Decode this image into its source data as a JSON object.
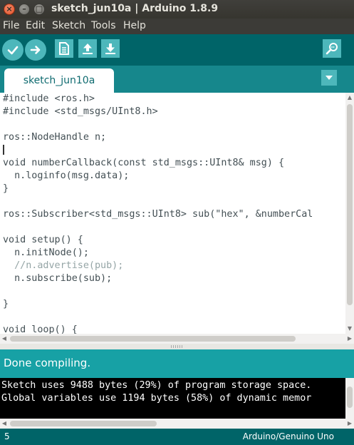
{
  "window": {
    "title": "sketch_jun10a | Arduino 1.8.9",
    "close_glyph": "×",
    "minimize_glyph": "–",
    "maximize_glyph": "□"
  },
  "menu": {
    "items": [
      "File",
      "Edit",
      "Sketch",
      "Tools",
      "Help"
    ]
  },
  "toolbar": {
    "buttons": [
      "verify-icon",
      "upload-icon",
      "new-icon",
      "open-icon",
      "save-icon",
      "serial-monitor-icon"
    ]
  },
  "tabs": {
    "active": "sketch_jun10a",
    "menu_icon": "chevron-down-icon"
  },
  "editor": {
    "lines": [
      "#include <ros.h>",
      "#include <std_msgs/UInt8.h>",
      "",
      "ros::NodeHandle n;",
      "",
      "void numberCallback(const std_msgs::UInt8& msg) {",
      "  n.loginfo(msg.data);",
      "}",
      "",
      "ros::Subscriber<std_msgs::UInt8> sub(\"hex\", &numberCal",
      "",
      "void setup() {",
      "  n.initNode();",
      "  //n.advertise(pub);",
      "  n.subscribe(sub);",
      "",
      "}",
      "",
      "void loop() {"
    ]
  },
  "status": {
    "message": "Done compiling."
  },
  "console": {
    "lines": [
      "Sketch uses 9488 bytes (29%) of program storage space.",
      "Global variables use 1194 bytes (58%) of dynamic memor"
    ]
  },
  "footer": {
    "line_number": "5",
    "board": "Arduino/Genuino Uno"
  },
  "colors": {
    "toolbar": "#006468",
    "tabstrip": "#16878c",
    "status": "#17a1a5",
    "button": "#4db7bb",
    "keyword": "#00979c"
  }
}
